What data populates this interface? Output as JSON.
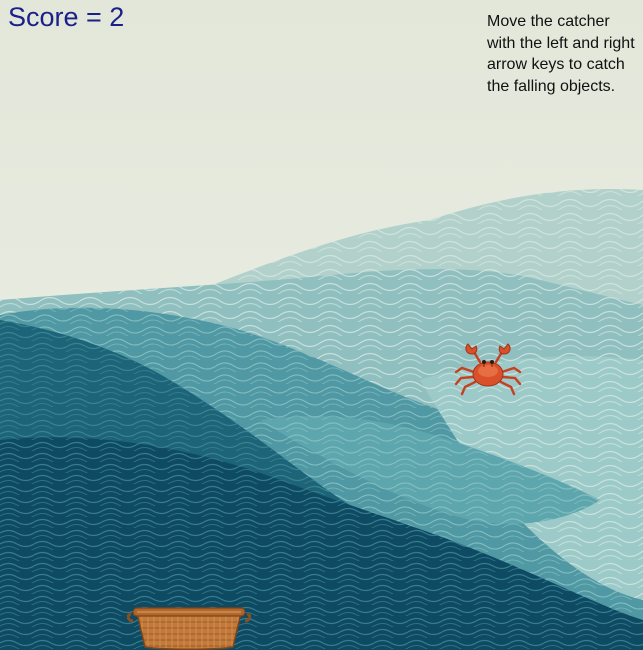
{
  "hud": {
    "score_text": "Score = 2",
    "score_value": 2,
    "instructions": "Move the catcher with the left and right arrow keys to catch the falling objects."
  },
  "objects": {
    "falling": "crab",
    "catcher": "basket"
  },
  "colors": {
    "sky": "#e9ece0",
    "wave_light": "#a9ccc6",
    "wave_mid": "#4e9aa4",
    "wave_dark": "#11506a",
    "score_text": "#1b1f8a",
    "crab": "#d9502b",
    "basket": "#c27a3a"
  }
}
